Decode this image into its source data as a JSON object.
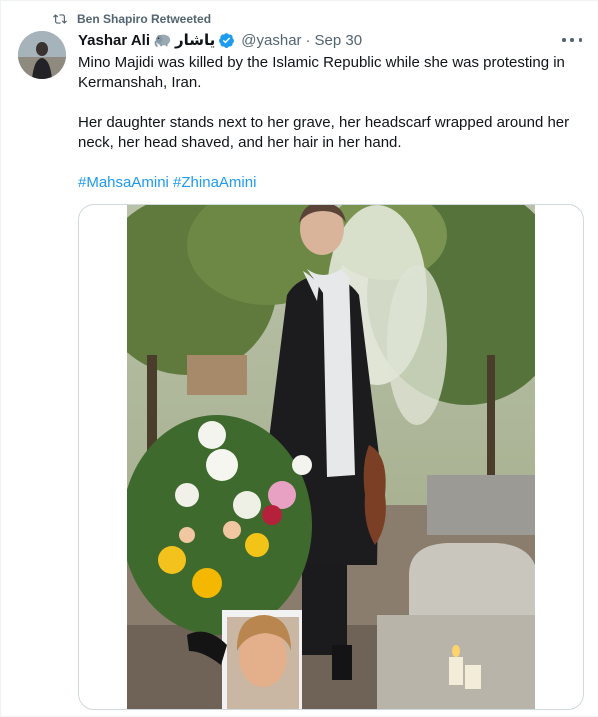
{
  "retweet": {
    "icon": "retweet-icon",
    "text": "Ben Shapiro Retweeted"
  },
  "author": {
    "name": "Yashar Ali",
    "emoji": "elephant-emoji",
    "name_farsi": "یاشار",
    "verified": true,
    "verified_color": "#1d9bf0",
    "handle": "@yashar",
    "separator": "·",
    "date": "Sep 30"
  },
  "tweet": {
    "line1": "Mino Majidi was killed by the Islamic Republic while she was protesting in Kermanshah, Iran.",
    "line2": "Her daughter stands next to her grave, her headscarf wrapped around her neck, her head shaved, and her hair in her hand.",
    "hashtags": [
      "#MahsaAmini",
      "#ZhinaAmini"
    ]
  },
  "media": {
    "description_icon": "photo"
  },
  "colors": {
    "text": "#0f1419",
    "secondary": "#536471",
    "link": "#1d9bf0",
    "border": "#cfd9de"
  }
}
